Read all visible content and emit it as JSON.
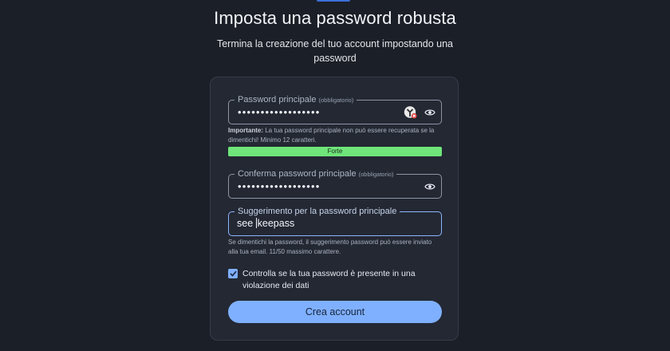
{
  "header": {
    "title": "Imposta una password robusta",
    "subtitle": "Termina la creazione del tuo account impostando una password"
  },
  "master_password": {
    "label": "Password principale",
    "required_tag": "(obbligatorio)",
    "value_masked": "••••••••••••••••••",
    "hint_bold": "Importante:",
    "hint": "La tua password principale non può essere recuperata se la dimentichi! Minimo 12 caratteri.",
    "strength_label": "Forte",
    "strength_fraction": 1.0
  },
  "confirm_password": {
    "label": "Conferma password principale",
    "required_tag": "(obbligatorio)",
    "value_masked": "••••••••••••••••••"
  },
  "password_hint": {
    "label": "Suggerimento per la password principale",
    "value_before_cursor": "see ",
    "value_after_cursor": "keepass",
    "help": "Se dimentichi la password, il suggerimento password può essere inviato alla tua email. 11/50 massimo carattere."
  },
  "breach_check": {
    "checked": true,
    "label": "Controlla se la tua password è presente in una violazione dei dati"
  },
  "submit": {
    "label": "Crea account"
  },
  "icons": {
    "extension": "password-manager-extension-icon",
    "visibility": "eye-icon",
    "check": "check-icon"
  },
  "colors": {
    "background": "#1b1f27",
    "card": "#232833",
    "accent": "#7fb0ff",
    "strength": "#6fe57a"
  }
}
